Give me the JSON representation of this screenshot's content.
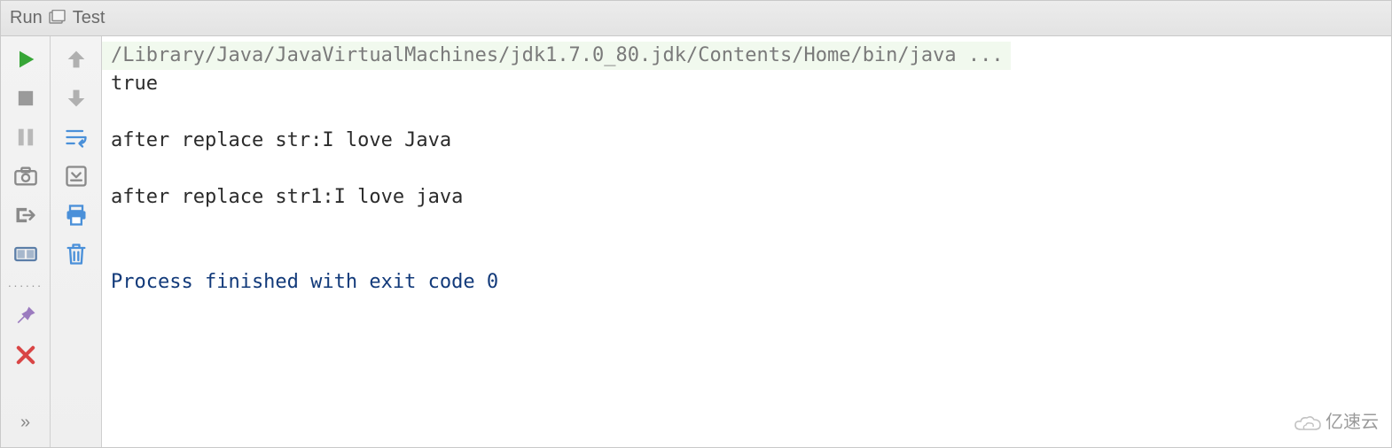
{
  "header": {
    "tool_window_title": "Run",
    "run_config_name": "Test"
  },
  "gutter_left": {
    "rerun": "rerun-icon",
    "stop": "stop-icon",
    "pause": "pause-icon",
    "dump": "dump-threads-icon",
    "exit": "exit-icon",
    "layout": "restore-layout-icon",
    "pin": "pin-icon",
    "close": "close-icon",
    "expand": "»"
  },
  "gutter_right": {
    "up": "up-icon",
    "down": "down-icon",
    "soft_wrap": "soft-wrap-icon",
    "scroll_end": "scroll-to-end-icon",
    "print": "print-icon",
    "clear": "clear-all-icon"
  },
  "console": {
    "command_line": "/Library/Java/JavaVirtualMachines/jdk1.7.0_80.jdk/Contents/Home/bin/java ...",
    "output_lines": [
      "true",
      "after replace str:I love Java",
      "after replace str1:I love java"
    ],
    "blank_line": "",
    "status_line": "Process finished with exit code 0"
  },
  "watermark": {
    "text": "亿速云"
  },
  "colors": {
    "run_green": "#4caf50",
    "stop_gray": "#9e9e9e",
    "pin_purple": "#9b7bbf",
    "close_red": "#d94545",
    "print_blue": "#4a90d9",
    "trash_blue": "#4a90d9",
    "status_blue": "#123a7a",
    "cmd_bg": "#f1f9ee"
  }
}
